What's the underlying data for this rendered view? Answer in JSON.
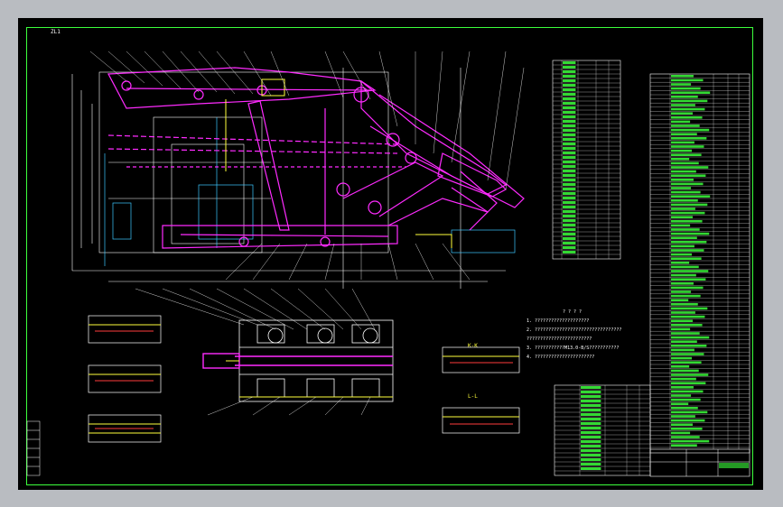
{
  "drawing": {
    "corner_label": "ZL1",
    "section_label_a": "L-L",
    "section_label_b": "K-K",
    "notes_title": "? ? ? ?",
    "notes": [
      "1. ????????????????????",
      "2. ????????????????????????????????",
      "   ????????????????????????",
      "3. ???????????M13.0-B/S???????????",
      "4. ??????????????????????"
    ],
    "title_block_name": "????",
    "title_block_sub": "??????"
  },
  "colors": {
    "background": "#000000",
    "outer": "#b9bcc1",
    "frame": "#3cff3c",
    "magenta": "#ff2bff",
    "white": "#ffffff",
    "yellow": "#ffff3c",
    "cyan": "#3cc8ff",
    "green": "#3cff3c",
    "red": "#ff3b3b"
  },
  "icons": {
    "balloon": "circle-callout-icon"
  }
}
